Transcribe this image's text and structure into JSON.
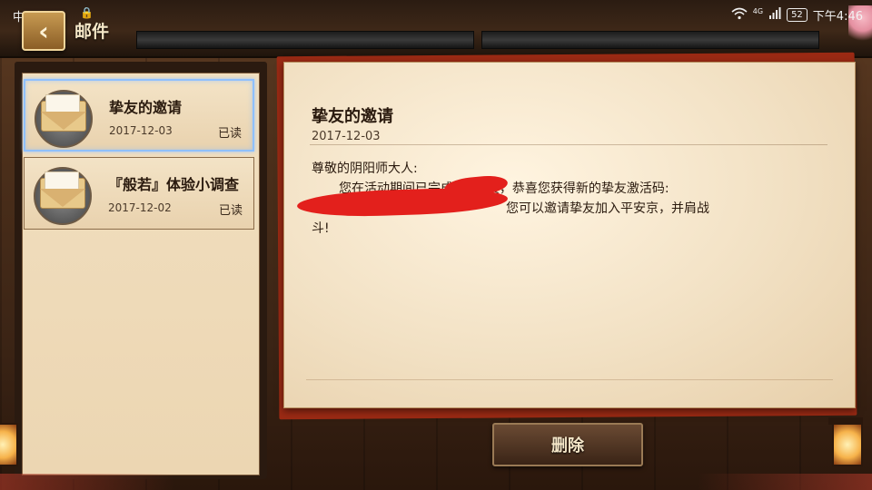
{
  "status_bar": {
    "carrier": "中国联通",
    "network": "4G",
    "battery": "52",
    "time": "下午4:46"
  },
  "header": {
    "title": "邮件",
    "back_icon": "chevron-left-icon"
  },
  "mail_list": {
    "items": [
      {
        "title": "挚友的邀请",
        "date": "2017-12-03",
        "status": "已读",
        "selected": true
      },
      {
        "title": "『般若』体验小调查",
        "date": "2017-12-02",
        "status": "已读",
        "selected": false
      }
    ]
  },
  "letter": {
    "title": "挚友的邀请",
    "date": "2017-12-03",
    "greeting": "尊敬的阴阳师大人:",
    "line1": "您在活动期间已完成6场比赛，恭喜您获得新的挚友激活码:",
    "line2": "您可以邀请挚友加入平安京，并肩战",
    "line3": "斗!"
  },
  "actions": {
    "delete_label": "删除"
  },
  "colors": {
    "selected_border": "#8fc0ff",
    "redaction": "#e3201c",
    "paper": "#f2e1c4"
  }
}
